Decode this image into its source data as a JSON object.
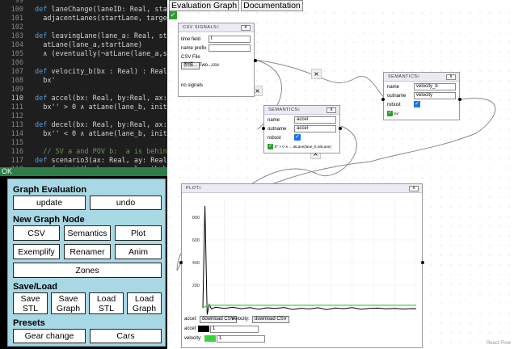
{
  "editor": {
    "lines": [
      {
        "n": "99",
        "text": ""
      },
      {
        "n": "100",
        "pre": "def",
        "text": " laneChange(laneID: Real, start"
      },
      {
        "n": "101",
        "text": "  adjacentLanes(startLane, target"
      },
      {
        "n": "102",
        "text": ""
      },
      {
        "n": "103",
        "pre": "def",
        "text": " leavingLane(lane_a: Real, star"
      },
      {
        "n": "104",
        "text": "  atLane(lane_a,startLane)"
      },
      {
        "n": "105",
        "text": "  ∧ (eventually(¬atLane(lane_a,s"
      },
      {
        "n": "106",
        "text": ""
      },
      {
        "n": "107",
        "pre": "def",
        "text": " velocity_b(bx : Real) : Real ="
      },
      {
        "n": "108",
        "text": "  bx'"
      },
      {
        "n": "109",
        "text": ""
      },
      {
        "n": "110",
        "pre": "def",
        "text": " accel(bx: Real, by:Real, ax:Re"
      },
      {
        "n": "111",
        "text": "  bx'' > 0 ∧ atLane(lane_b, init"
      },
      {
        "n": "112",
        "text": ""
      },
      {
        "n": "113",
        "pre": "def",
        "text": " decel(bx: Real, by:Real, ax: R"
      },
      {
        "n": "114",
        "text": "  bx'' < 0 ∧ atLane(lane_b, init"
      },
      {
        "n": "115",
        "text": ""
      },
      {
        "n": "116",
        "comment": true,
        "text": "  // SV a and POV b:  a is behind b"
      },
      {
        "n": "117",
        "pre": "def",
        "text": " scenario3(ax: Real, ay: Real,"
      },
      {
        "n": "118",
        "text": "  safe init(bx by av ay length b"
      }
    ],
    "status": "OK"
  },
  "panel": {
    "graph_evaluation": {
      "title": "Graph Evaluation",
      "update": "update",
      "undo": "undo"
    },
    "new_node": {
      "title": "New Graph Node",
      "csv": "CSV",
      "semantics": "Semantics",
      "plot": "Plot",
      "exemplify": "Exemplify",
      "renamer": "Renamer",
      "anim": "Anim",
      "zones": "Zones"
    },
    "save_load": {
      "title": "Save/Load",
      "save_stl": "Save STL",
      "save_graph": "Save Graph",
      "load_stl": "Load STL",
      "load_graph": "Load Graph"
    },
    "presets": {
      "title": "Presets",
      "gear_change": "Gear change",
      "cars": "Cars"
    }
  },
  "tabs": [
    "Evaluation Graph",
    "Documentation"
  ],
  "csv_node": {
    "title": "CSV SIGNALS",
    "time_field_label": "time field",
    "time_field_value": "t",
    "name_prefix_label": "name prefix",
    "name_prefix_value": "",
    "file_label": "CSV File",
    "browse": "参照...",
    "file_name": "Two...csv",
    "status": "no signals",
    "close": "x"
  },
  "sem_node_1": {
    "title": "SEMANTICS",
    "name_label": "name",
    "name_value": "accel",
    "outname_label": "outname",
    "outname_value": "accel",
    "robust_label": "robust",
    "formula": "b'' > 0 ∧ ... atLane(lane_b,initLane)",
    "close": "x"
  },
  "sem_node_2": {
    "title": "SEMANTICS",
    "name_label": "name",
    "name_value": "velocity_b",
    "outname_label": "outname",
    "outname_value": "velocity",
    "robust_label": "robust",
    "formula": "bx'",
    "close": "x"
  },
  "plot_node": {
    "title": "PLOT",
    "close": "x",
    "legend": {
      "accel": "accel:",
      "velocity": "velocity:",
      "download": "download CSV",
      "accel_val": "1",
      "velocity_val": "1"
    }
  },
  "colors": {
    "accel": "#000000",
    "velocity": "#39d43a",
    "panel": "#a9d8e5",
    "ok": "#2d7d46"
  },
  "chart_data": {
    "type": "line",
    "title": "",
    "xlabel": "",
    "ylabel": "",
    "y_ticks": [
      200,
      400,
      600,
      800
    ],
    "ylim": [
      -100,
      950
    ],
    "grid": true,
    "series": [
      {
        "name": "accel",
        "x": [
          0,
          1,
          2,
          3,
          4,
          6,
          10,
          14,
          18,
          22,
          26,
          30,
          34,
          38,
          42,
          46,
          50,
          54,
          58,
          62,
          66,
          70,
          74,
          78,
          82,
          86,
          90,
          94,
          98,
          100
        ],
        "values": [
          0,
          900,
          -60,
          30,
          -10,
          5,
          -5,
          4,
          -8,
          2,
          -12,
          0,
          -6,
          3,
          -14,
          -4,
          -10,
          1,
          -16,
          -2,
          -8,
          2,
          -12,
          -5,
          -3,
          -9,
          -6,
          -11,
          -7,
          -8
        ]
      },
      {
        "name": "velocity",
        "x": [
          0,
          2,
          4,
          100
        ],
        "values": [
          0,
          20,
          22,
          22
        ]
      }
    ]
  },
  "watermark": "React Flow"
}
